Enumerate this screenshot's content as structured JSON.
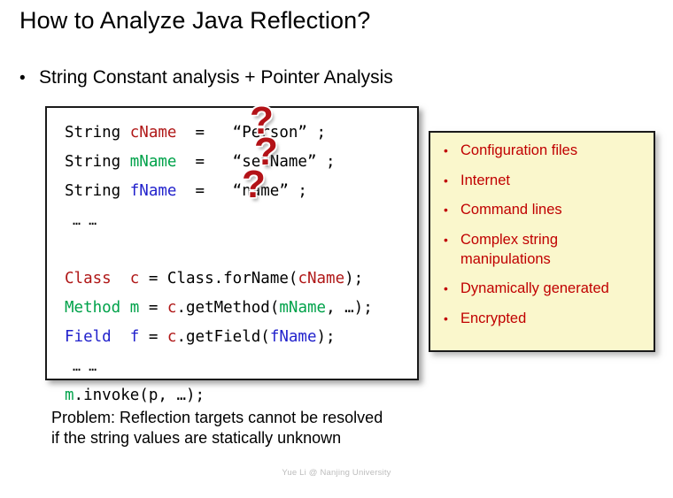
{
  "slide": {
    "title": "How to Analyze Java Reflection?",
    "bullet_glyph": "•",
    "top_bullet": "String Constant analysis + Pointer Analysis",
    "problem_note_line1": "Problem: Reflection targets cannot be resolved",
    "problem_note_line2": "if the string values are statically unknown",
    "footer": "Yue Li @ Nanjing University"
  },
  "code": {
    "lines": [
      {
        "id": "line-cname",
        "tokens": [
          {
            "t": "String ",
            "c": "black"
          },
          {
            "t": "cName",
            "c": "red"
          },
          {
            "t": "  =   “Person” ;",
            "c": "black"
          }
        ]
      },
      {
        "id": "line-mname",
        "tokens": [
          {
            "t": "String ",
            "c": "black"
          },
          {
            "t": "mName",
            "c": "green"
          },
          {
            "t": "  =   “setName” ;",
            "c": "black"
          }
        ]
      },
      {
        "id": "line-fname",
        "tokens": [
          {
            "t": "String ",
            "c": "black"
          },
          {
            "t": "fName",
            "c": "blue"
          },
          {
            "t": "  =   “name” ;",
            "c": "black"
          }
        ]
      },
      {
        "id": "line-ellipsis-1",
        "small": true,
        "tokens": [
          {
            "t": " … …",
            "c": "black"
          }
        ]
      },
      {
        "id": "line-blank-1",
        "tokens": [
          {
            "t": " ",
            "c": "black"
          }
        ]
      },
      {
        "id": "line-class",
        "tokens": [
          {
            "t": "Class",
            "c": "red"
          },
          {
            "t": "  ",
            "c": "black"
          },
          {
            "t": "c",
            "c": "red"
          },
          {
            "t": " = Class.forName(",
            "c": "black"
          },
          {
            "t": "cName",
            "c": "red"
          },
          {
            "t": ");",
            "c": "black"
          }
        ]
      },
      {
        "id": "line-method",
        "tokens": [
          {
            "t": "Method",
            "c": "green"
          },
          {
            "t": " ",
            "c": "black"
          },
          {
            "t": "m",
            "c": "green"
          },
          {
            "t": " = ",
            "c": "black"
          },
          {
            "t": "c",
            "c": "red"
          },
          {
            "t": ".getMethod(",
            "c": "black"
          },
          {
            "t": "mName",
            "c": "green"
          },
          {
            "t": ", …);",
            "c": "black"
          }
        ]
      },
      {
        "id": "line-field",
        "tokens": [
          {
            "t": "Field",
            "c": "blue"
          },
          {
            "t": "  ",
            "c": "black"
          },
          {
            "t": "f",
            "c": "blue"
          },
          {
            "t": " = ",
            "c": "black"
          },
          {
            "t": "c",
            "c": "red"
          },
          {
            "t": ".getField(",
            "c": "black"
          },
          {
            "t": "fName",
            "c": "blue"
          },
          {
            "t": ");",
            "c": "black"
          }
        ]
      },
      {
        "id": "line-ellipsis-2",
        "small": true,
        "tokens": [
          {
            "t": " … …",
            "c": "black"
          }
        ]
      },
      {
        "id": "line-invoke",
        "tokens": [
          {
            "t": "m",
            "c": "green"
          },
          {
            "t": ".invoke(p, …);",
            "c": "black"
          }
        ]
      }
    ],
    "question_marks": [
      "?",
      "?",
      "?"
    ]
  },
  "callout": {
    "items": [
      "Configuration files",
      "Internet",
      "Command lines",
      "Complex string manipulations",
      "Dynamically generated",
      "Encrypted"
    ],
    "bullet_glyph": "•"
  },
  "colors": {
    "callout_bg": "#FAF7CC",
    "callout_text": "#C00000",
    "code_red": "#B01818",
    "code_green": "#00A24A",
    "code_blue": "#2222CC",
    "qmark": "#B31217",
    "footer_text": "#BDBDBD"
  }
}
